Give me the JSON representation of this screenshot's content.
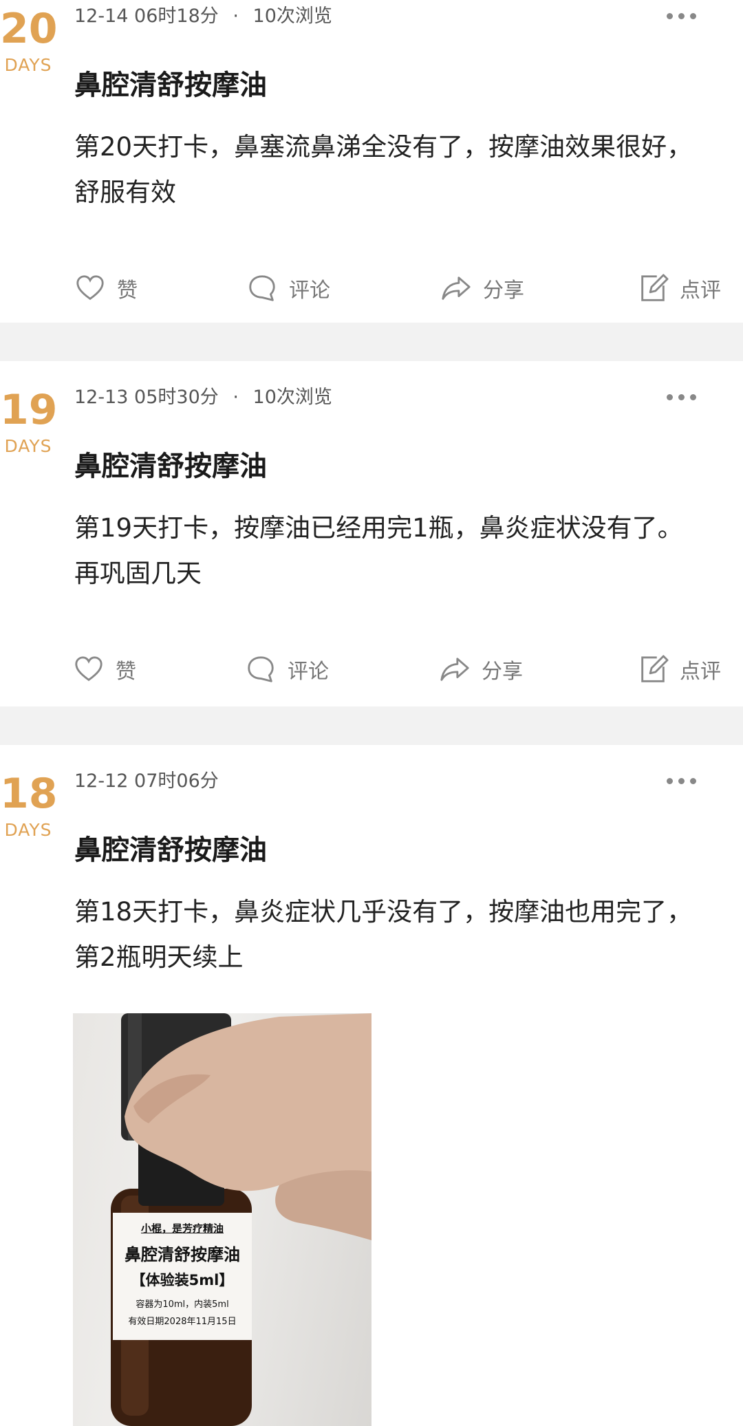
{
  "posts": [
    {
      "day_number": "20",
      "day_label": "DAYS",
      "date": "12-14 06时18分",
      "dot": "·",
      "views": "10次浏览",
      "title": "鼻腔清舒按摩油",
      "content": "第20天打卡，鼻塞流鼻涕全没有了，按摩油效果很好，舒服有效",
      "actions": {
        "like": "赞",
        "comment": "评论",
        "share": "分享",
        "review": "点评"
      }
    },
    {
      "day_number": "19",
      "day_label": "DAYS",
      "date": "12-13 05时30分",
      "dot": "·",
      "views": "10次浏览",
      "title": "鼻腔清舒按摩油",
      "content": "第19天打卡，按摩油已经用完1瓶，鼻炎症状没有了。再巩固几天",
      "actions": {
        "like": "赞",
        "comment": "评论",
        "share": "分享",
        "review": "点评"
      }
    },
    {
      "day_number": "18",
      "day_label": "DAYS",
      "date": "12-12 07时06分",
      "title": "鼻腔清舒按摩油",
      "content": "第18天打卡，鼻炎症状几乎没有了，按摩油也用完了，第2瓶明天续上",
      "photo": {
        "label_line1": "小棍，是芳疗精油",
        "label_line2": "鼻腔清舒按摩油",
        "label_line3": "【体验装5ml】",
        "label_line4": "容器为10ml，内装5ml",
        "label_line5": "有效日期2028年11月15日"
      }
    }
  ],
  "colors": {
    "accent": "#e0a253",
    "separator": "#f2f2f2",
    "muted": "#777777"
  },
  "icons": [
    "heart-icon",
    "comment-bubble-icon",
    "share-arrow-icon",
    "edit-review-icon",
    "more-dots-icon"
  ]
}
